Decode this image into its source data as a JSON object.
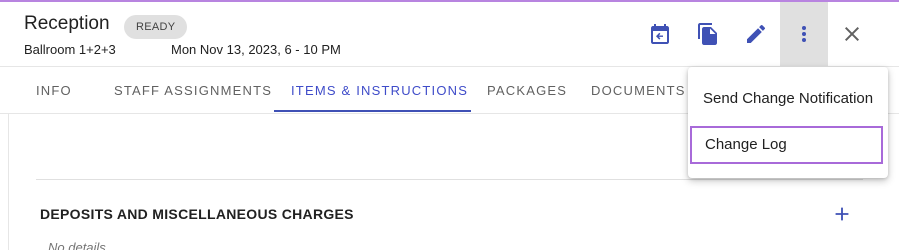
{
  "header": {
    "title": "Reception",
    "status": "READY",
    "location": "Ballroom 1+2+3",
    "datetime": "Mon Nov 13, 2023, 6 - 10 PM"
  },
  "toolbar": {
    "icons": [
      "calendar-arrow-icon",
      "copy-document-icon",
      "edit-pencil-icon",
      "more-vert-icon",
      "close-icon"
    ],
    "accent_color": "#3f51b5"
  },
  "tabs": [
    {
      "label": "INFO"
    },
    {
      "label": "STAFF ASSIGNMENTS"
    },
    {
      "label": "ITEMS & INSTRUCTIONS",
      "active": true
    },
    {
      "label": "PACKAGES"
    },
    {
      "label": "DOCUMENTS"
    }
  ],
  "content": {
    "section_title": "DEPOSITS AND MISCELLANEOUS CHARGES",
    "empty_text": "No details"
  },
  "menu": {
    "items": [
      {
        "label": "Send Change Notification"
      },
      {
        "label": "Change Log",
        "highlighted": true
      }
    ],
    "highlight_color": "#a86ad9"
  }
}
